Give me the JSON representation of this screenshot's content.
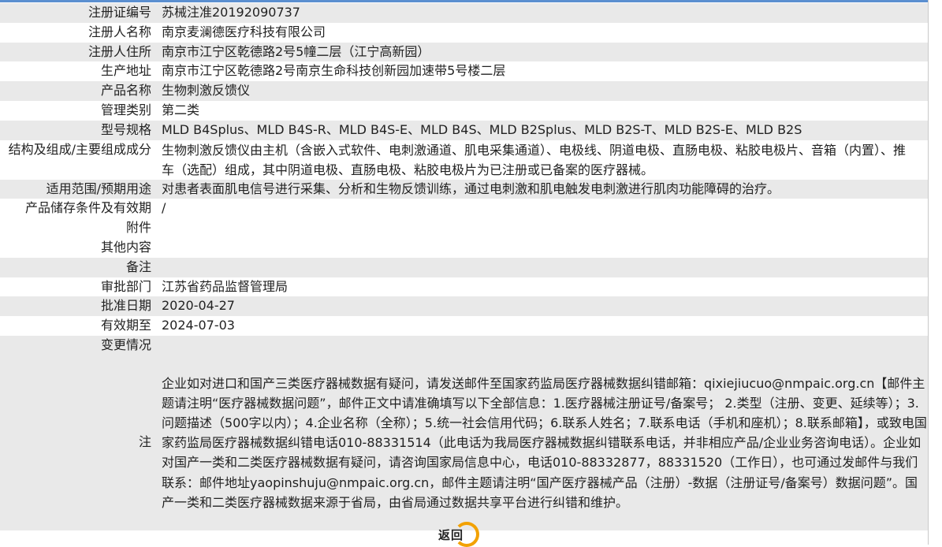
{
  "fields": [
    {
      "label": "注册证编号",
      "value": "苏械注准20192090737"
    },
    {
      "label": "注册人名称",
      "value": "南京麦澜德医疗科技有限公司"
    },
    {
      "label": "注册人住所",
      "value": "南京市江宁区乾德路2号5幢二层（江宁高新园）"
    },
    {
      "label": "生产地址",
      "value": "南京市江宁区乾德路2号南京生命科技创新园加速带5号楼二层"
    },
    {
      "label": "产品名称",
      "value": "生物刺激反馈仪"
    },
    {
      "label": "管理类别",
      "value": "第二类"
    },
    {
      "label": "型号规格",
      "value": "MLD B4Splus、MLD B4S-R、MLD B4S-E、MLD B4S、MLD B2Splus、MLD B2S-T、MLD B2S-E、MLD B2S"
    },
    {
      "label": "结构及组成/主要组成成分",
      "value": "生物刺激反馈仪由主机（含嵌入式软件、电刺激通道、肌电采集通道）、电极线、阴道电极、直肠电极、粘胶电极片、音箱（内置）、推车（选配）组成，其中阴道电极、直肠电极、粘胶电极片为已注册或已备案的医疗器械。"
    },
    {
      "label": "适用范围/预期用途",
      "value": "对患者表面肌电信号进行采集、分析和生物反馈训练，通过电刺激和肌电触发电刺激进行肌肉功能障碍的治疗。"
    },
    {
      "label": "产品储存条件及有效期",
      "value": "/"
    },
    {
      "label": "附件",
      "value": ""
    },
    {
      "label": "其他内容",
      "value": ""
    },
    {
      "label": "备注",
      "value": ""
    },
    {
      "label": "审批部门",
      "value": "江苏省药品监督管理局"
    },
    {
      "label": "批准日期",
      "value": "2020-04-27"
    },
    {
      "label": "有效期至",
      "value": "2024-07-03"
    },
    {
      "label": "变更情况",
      "value": ""
    }
  ],
  "note": {
    "label": "注",
    "text": "企业如对进口和国产三类医疗器械数据有疑问，请发送邮件至国家药监局医疗器械数据纠错邮箱：qixiejiucuo@nmpaic.org.cn【邮件主题请注明“医疗器械数据问题”，邮件正文中请准确填写以下全部信息：1.医疗器械注册证号/备案号； 2.类型（注册、变更、延续等）；3.问题描述（500字以内）；4.企业名称（全称）；5.统一社会信用代码；6.联系人姓名；7.联系电话（手机和座机）；8.联系邮箱】，或致电国家药监局医疗器械数据纠错电话010-88331514（此电话为我局医疗器械数据纠错联系电话，并非相应产品/企业业务咨询电话）。企业如对国产一类和二类医疗器械数据有疑问，请咨询国家局信息中心，电话010-88332877，88331520（工作日），也可通过发邮件与我们联系：邮件地址yaopinshuju@nmpaic.org.cn，邮件主题请注明“国产医疗器械产品（注册）-数据（注册证号/备案号）数据问题”。国产一类和二类医疗器械数据来源于省局，由省局通过数据共享平台进行纠错和维护。"
  },
  "return_button": {
    "label": "返回"
  },
  "colors": {
    "top_bar": "#5b8fd0",
    "row_gray": "#e9e9e9",
    "return_ring": "#f2a100"
  }
}
